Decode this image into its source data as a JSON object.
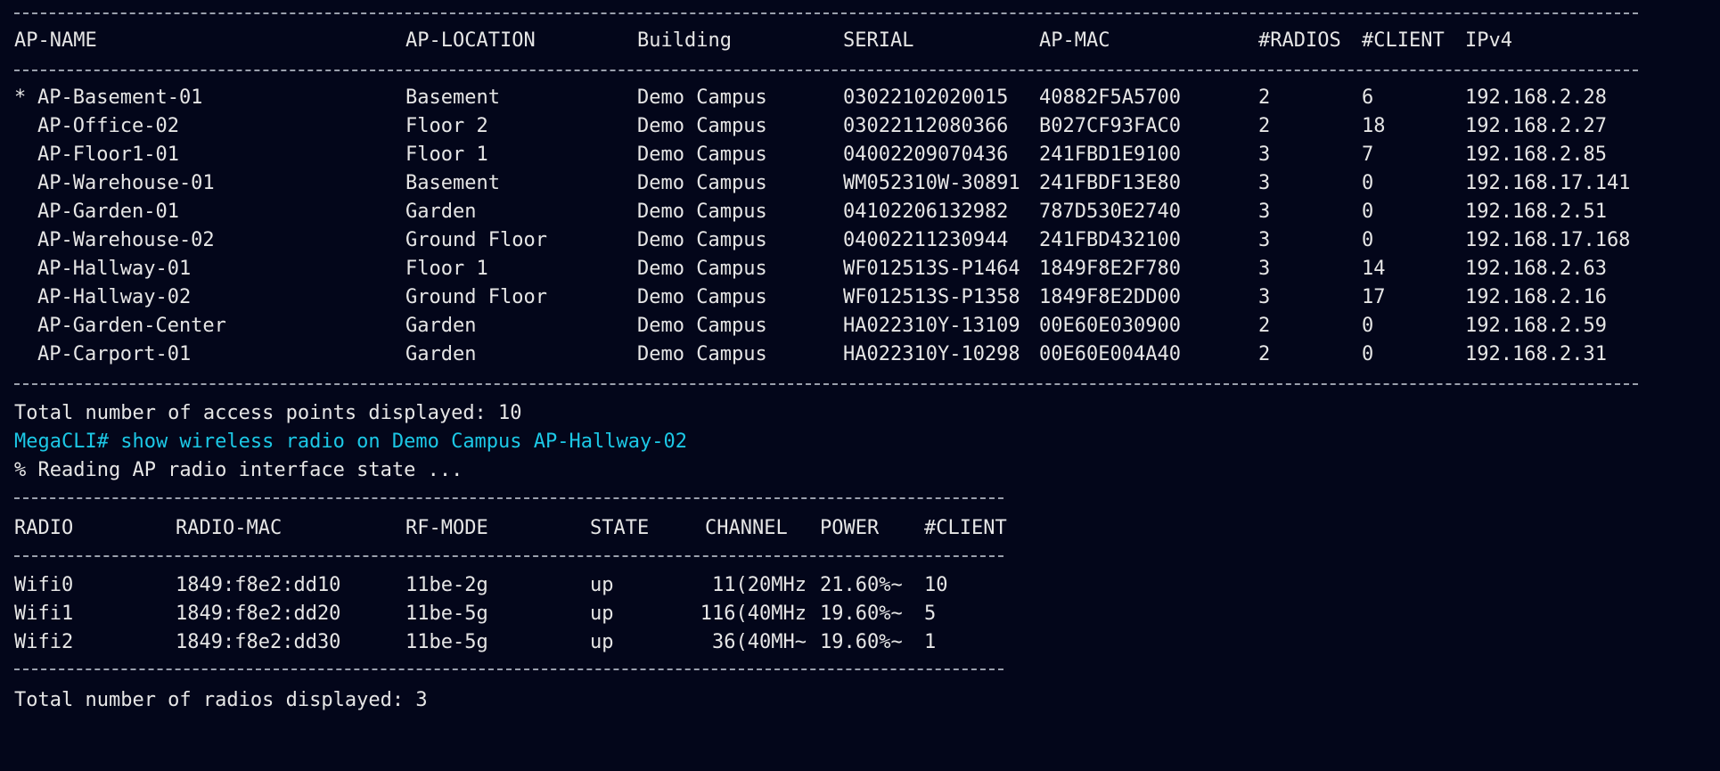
{
  "ap_table": {
    "headers": [
      "AP-NAME",
      "AP-LOCATION",
      "Building",
      "SERIAL",
      "AP-MAC",
      "#RADIOS",
      "#CLIENT",
      "IPv4"
    ],
    "rows": [
      {
        "marker": "*",
        "cells": [
          "AP-Basement-01",
          "Basement",
          "Demo Campus",
          "03022102020015",
          "40882F5A5700",
          "2",
          "6",
          "192.168.2.28"
        ]
      },
      {
        "marker": "",
        "cells": [
          "AP-Office-02",
          "Floor 2",
          "Demo Campus",
          "03022112080366",
          "B027CF93FAC0",
          "2",
          "18",
          "192.168.2.27"
        ]
      },
      {
        "marker": "",
        "cells": [
          "AP-Floor1-01",
          "Floor 1",
          "Demo Campus",
          "04002209070436",
          "241FBD1E9100",
          "3",
          "7",
          "192.168.2.85"
        ]
      },
      {
        "marker": "",
        "cells": [
          "AP-Warehouse-01",
          "Basement",
          "Demo Campus",
          "WM052310W-30891",
          "241FBDF13E80",
          "3",
          "0",
          "192.168.17.141"
        ]
      },
      {
        "marker": "",
        "cells": [
          "AP-Garden-01",
          "Garden",
          "Demo Campus",
          "04102206132982",
          "787D530E2740",
          "3",
          "0",
          "192.168.2.51"
        ]
      },
      {
        "marker": "",
        "cells": [
          "AP-Warehouse-02",
          "Ground Floor",
          "Demo Campus",
          "04002211230944",
          "241FBD432100",
          "3",
          "0",
          "192.168.17.168"
        ]
      },
      {
        "marker": "",
        "cells": [
          "AP-Hallway-01",
          "Floor 1",
          "Demo Campus",
          "WF012513S-P1464",
          "1849F8E2F780",
          "3",
          "14",
          "192.168.2.63"
        ]
      },
      {
        "marker": "",
        "cells": [
          "AP-Hallway-02",
          "Ground Floor",
          "Demo Campus",
          "WF012513S-P1358",
          "1849F8E2DD00",
          "3",
          "17",
          "192.168.2.16"
        ]
      },
      {
        "marker": "",
        "cells": [
          "AP-Garden-Center",
          "Garden",
          "Demo Campus",
          "HA022310Y-13109",
          "00E60E030900",
          "2",
          "0",
          "192.168.2.59"
        ]
      },
      {
        "marker": "",
        "cells": [
          "AP-Carport-01",
          "Garden",
          "Demo Campus",
          "HA022310Y-10298",
          "00E60E004A40",
          "2",
          "0",
          "192.168.2.31"
        ]
      }
    ],
    "total_line": "Total number of access points displayed: 10"
  },
  "command": {
    "prompt_line": "MegaCLI# show wireless radio on Demo Campus AP-Hallway-02",
    "status_line": "% Reading AP radio interface state ..."
  },
  "radio_table": {
    "headers": [
      "RADIO",
      "RADIO-MAC",
      "RF-MODE",
      "STATE",
      "CHANNEL",
      "POWER",
      "#CLIENT"
    ],
    "rows": [
      [
        "Wifi0",
        "1849:f8e2:dd10",
        "11be-2g",
        "up",
        "11(20MHz",
        "21.60%~",
        "10"
      ],
      [
        "Wifi1",
        "1849:f8e2:dd20",
        "11be-5g",
        "up",
        "116(40MHz",
        "19.60%~",
        "5"
      ],
      [
        "Wifi2",
        "1849:f8e2:dd30",
        "11be-5g",
        "up",
        "36(40MH~",
        "19.60%~",
        "1"
      ]
    ],
    "total_line": "Total number of radios displayed: 3"
  },
  "colors": {
    "background": "#03061a",
    "text": "#e6e6e6",
    "prompt": "#1cc8e6",
    "rule": "#9aa0ad"
  }
}
